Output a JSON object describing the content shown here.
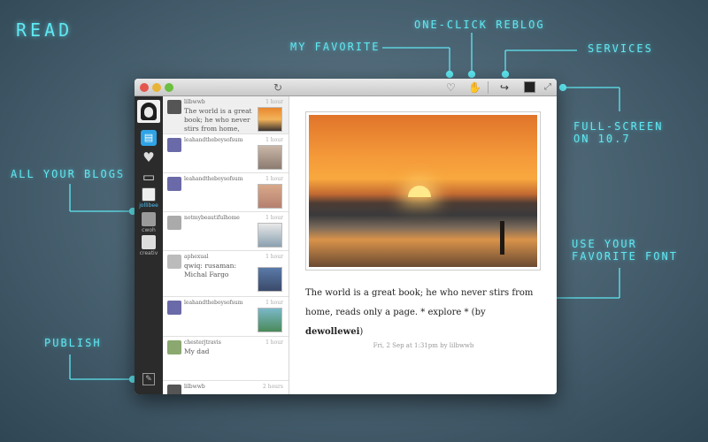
{
  "heading": "READ",
  "callouts": {
    "favorite": "My favorite",
    "reblog": "One-click reblog",
    "services": "services",
    "fullscreen_line1": "Full-screen",
    "fullscreen_line2": "on 10.7",
    "blogs": "All your blogs",
    "font_line1": "Use your",
    "font_line2": "favorite font",
    "publish": "Publish"
  },
  "toolbar": {
    "refresh_icon": "refresh-icon",
    "heart_icon": "heart-icon",
    "reblog_icon": "reblog-icon",
    "share_icon": "share-icon",
    "fullscreen_icon": "fullscreen-icon"
  },
  "sidebar": {
    "blogs": [
      {
        "name": "jollibee",
        "selected": true
      },
      {
        "name": "cwoh",
        "selected": false
      },
      {
        "name": "creativ",
        "selected": false
      }
    ]
  },
  "feed": {
    "posts": [
      {
        "user": "lilbwwb",
        "time": "1 hour",
        "snippet": "The world is a great book; he who never stirs from home, reads"
      },
      {
        "user": "leahandtheboysofsum",
        "time": "1 hour",
        "snippet": ""
      },
      {
        "user": "leahandtheboysofsum",
        "time": "1 hour",
        "snippet": ""
      },
      {
        "user": "notmybeautifulhome",
        "time": "1 hour",
        "snippet": ""
      },
      {
        "user": "aphexual",
        "time": "1 hour",
        "snippet": "qwiq: rusaman: Michal Fargo"
      },
      {
        "user": "leahandtheboysofsum",
        "time": "1 hour",
        "snippet": ""
      },
      {
        "user": "chesterjtravis",
        "time": "1 hour",
        "snippet": "My dad"
      },
      {
        "user": "lilbwwb",
        "time": "2 hours",
        "snippet": ""
      }
    ]
  },
  "main": {
    "caption_text": "The world is a great book; he who never stirs from home, reads only a page. * explore * (by",
    "caption_author": "dewollewei",
    "caption_close": ")",
    "meta": "Fri, 2 Sep at 1:31pm by lilbwwb"
  },
  "colors": {
    "accent": "#5fe8f2",
    "selected_blue": "#2fa3e6"
  }
}
